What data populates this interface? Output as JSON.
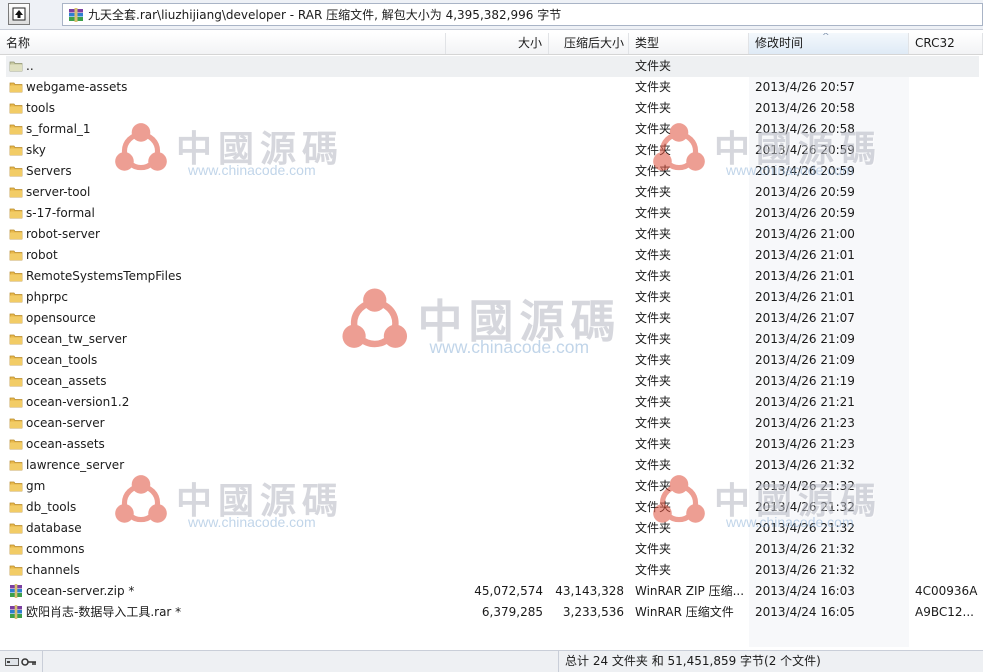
{
  "path_bar": {
    "path": "九天全套.rar\\liuzhijiang\\developer - RAR 压缩文件, 解包大小为 4,395,382,996 字节"
  },
  "columns": {
    "name": "名称",
    "size": "大小",
    "packed": "压缩后大小",
    "type": "类型",
    "modified": "修改时间",
    "crc": "CRC32"
  },
  "rows": [
    {
      "name": "..",
      "size": "",
      "packed": "",
      "type": "文件夹",
      "modified": "",
      "crc": "",
      "icon": "parent-folder-icon"
    },
    {
      "name": "webgame-assets",
      "size": "",
      "packed": "",
      "type": "文件夹",
      "modified": "2013/4/26 20:57",
      "crc": "",
      "icon": "folder-icon"
    },
    {
      "name": "tools",
      "size": "",
      "packed": "",
      "type": "文件夹",
      "modified": "2013/4/26 20:58",
      "crc": "",
      "icon": "folder-icon"
    },
    {
      "name": "s_formal_1",
      "size": "",
      "packed": "",
      "type": "文件夹",
      "modified": "2013/4/26 20:58",
      "crc": "",
      "icon": "folder-icon"
    },
    {
      "name": "sky",
      "size": "",
      "packed": "",
      "type": "文件夹",
      "modified": "2013/4/26 20:59",
      "crc": "",
      "icon": "folder-icon"
    },
    {
      "name": "Servers",
      "size": "",
      "packed": "",
      "type": "文件夹",
      "modified": "2013/4/26 20:59",
      "crc": "",
      "icon": "folder-icon"
    },
    {
      "name": "server-tool",
      "size": "",
      "packed": "",
      "type": "文件夹",
      "modified": "2013/4/26 20:59",
      "crc": "",
      "icon": "folder-icon"
    },
    {
      "name": "s-17-formal",
      "size": "",
      "packed": "",
      "type": "文件夹",
      "modified": "2013/4/26 20:59",
      "crc": "",
      "icon": "folder-icon"
    },
    {
      "name": "robot-server",
      "size": "",
      "packed": "",
      "type": "文件夹",
      "modified": "2013/4/26 21:00",
      "crc": "",
      "icon": "folder-icon"
    },
    {
      "name": "robot",
      "size": "",
      "packed": "",
      "type": "文件夹",
      "modified": "2013/4/26 21:01",
      "crc": "",
      "icon": "folder-icon"
    },
    {
      "name": "RemoteSystemsTempFiles",
      "size": "",
      "packed": "",
      "type": "文件夹",
      "modified": "2013/4/26 21:01",
      "crc": "",
      "icon": "folder-icon"
    },
    {
      "name": "phprpc",
      "size": "",
      "packed": "",
      "type": "文件夹",
      "modified": "2013/4/26 21:01",
      "crc": "",
      "icon": "folder-icon"
    },
    {
      "name": "opensource",
      "size": "",
      "packed": "",
      "type": "文件夹",
      "modified": "2013/4/26 21:07",
      "crc": "",
      "icon": "folder-icon"
    },
    {
      "name": "ocean_tw_server",
      "size": "",
      "packed": "",
      "type": "文件夹",
      "modified": "2013/4/26 21:09",
      "crc": "",
      "icon": "folder-icon"
    },
    {
      "name": "ocean_tools",
      "size": "",
      "packed": "",
      "type": "文件夹",
      "modified": "2013/4/26 21:09",
      "crc": "",
      "icon": "folder-icon"
    },
    {
      "name": "ocean_assets",
      "size": "",
      "packed": "",
      "type": "文件夹",
      "modified": "2013/4/26 21:19",
      "crc": "",
      "icon": "folder-icon"
    },
    {
      "name": "ocean-version1.2",
      "size": "",
      "packed": "",
      "type": "文件夹",
      "modified": "2013/4/26 21:21",
      "crc": "",
      "icon": "folder-icon"
    },
    {
      "name": "ocean-server",
      "size": "",
      "packed": "",
      "type": "文件夹",
      "modified": "2013/4/26 21:23",
      "crc": "",
      "icon": "folder-icon"
    },
    {
      "name": "ocean-assets",
      "size": "",
      "packed": "",
      "type": "文件夹",
      "modified": "2013/4/26 21:23",
      "crc": "",
      "icon": "folder-icon"
    },
    {
      "name": "lawrence_server",
      "size": "",
      "packed": "",
      "type": "文件夹",
      "modified": "2013/4/26 21:32",
      "crc": "",
      "icon": "folder-icon"
    },
    {
      "name": "gm",
      "size": "",
      "packed": "",
      "type": "文件夹",
      "modified": "2013/4/26 21:32",
      "crc": "",
      "icon": "folder-icon"
    },
    {
      "name": "db_tools",
      "size": "",
      "packed": "",
      "type": "文件夹",
      "modified": "2013/4/26 21:32",
      "crc": "",
      "icon": "folder-icon"
    },
    {
      "name": "database",
      "size": "",
      "packed": "",
      "type": "文件夹",
      "modified": "2013/4/26 21:32",
      "crc": "",
      "icon": "folder-icon"
    },
    {
      "name": "commons",
      "size": "",
      "packed": "",
      "type": "文件夹",
      "modified": "2013/4/26 21:32",
      "crc": "",
      "icon": "folder-icon"
    },
    {
      "name": "channels",
      "size": "",
      "packed": "",
      "type": "文件夹",
      "modified": "2013/4/26 21:32",
      "crc": "",
      "icon": "folder-icon"
    },
    {
      "name": "ocean-server.zip *",
      "size": "45,072,574",
      "packed": "43,143,328",
      "type": "WinRAR ZIP 压缩...",
      "modified": "2013/4/24 16:03",
      "crc": "4C00936A",
      "icon": "rar-archive-icon"
    },
    {
      "name": "欧阳肖志-数据导入工具.rar *",
      "size": "6,379,285",
      "packed": "3,233,536",
      "type": "WinRAR 压缩文件",
      "modified": "2013/4/24 16:05",
      "crc": "A9BC12...",
      "icon": "rar-archive-icon"
    }
  ],
  "watermark": {
    "text": "中國源碼",
    "url": "www.chinacode.com"
  },
  "status_bar": {
    "summary": "总计 24 文件夹 和 51,451,859 字节(2 个文件)"
  },
  "colors": {
    "folder": "#e8b84a",
    "selection_row": "#eef0f2",
    "sorted_header": "#dfeaf6",
    "watermark_logo": "#e0503c"
  }
}
